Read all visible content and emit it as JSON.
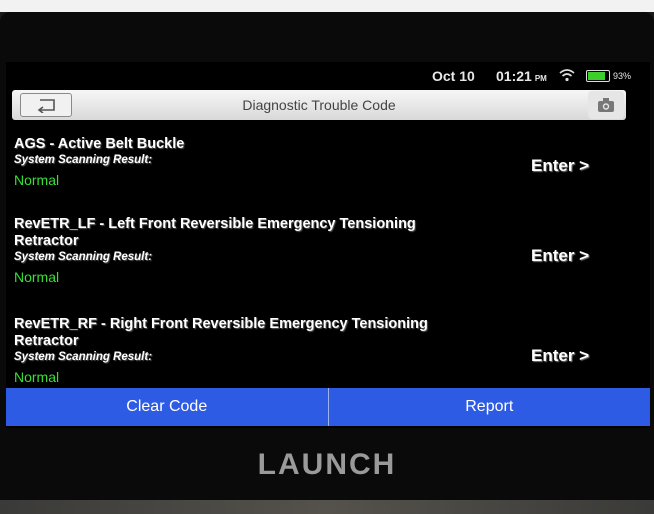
{
  "status": {
    "date": "Oct 10",
    "time": "01:21",
    "ampm": "PM",
    "battery": "93%"
  },
  "header": {
    "title": "Diagnostic Trouble Code"
  },
  "items": [
    {
      "title": "AGS - Active Belt Buckle",
      "subtitle": "System Scanning Result:",
      "status": "Normal",
      "enter": "Enter >"
    },
    {
      "title": "RevETR_LF - Left Front Reversible Emergency Tensioning Retractor",
      "subtitle": "System Scanning Result:",
      "status": "Normal",
      "enter": "Enter >"
    },
    {
      "title": "RevETR_RF - Right Front Reversible Emergency Tensioning Retractor",
      "subtitle": "System Scanning Result:",
      "status": "Normal",
      "enter": "Enter >"
    }
  ],
  "actions": {
    "clear": "Clear Code",
    "report": "Report"
  },
  "brand": "LAUNCH",
  "colors": {
    "status_ok": "#36e036",
    "action_bar": "#2d5be3"
  }
}
